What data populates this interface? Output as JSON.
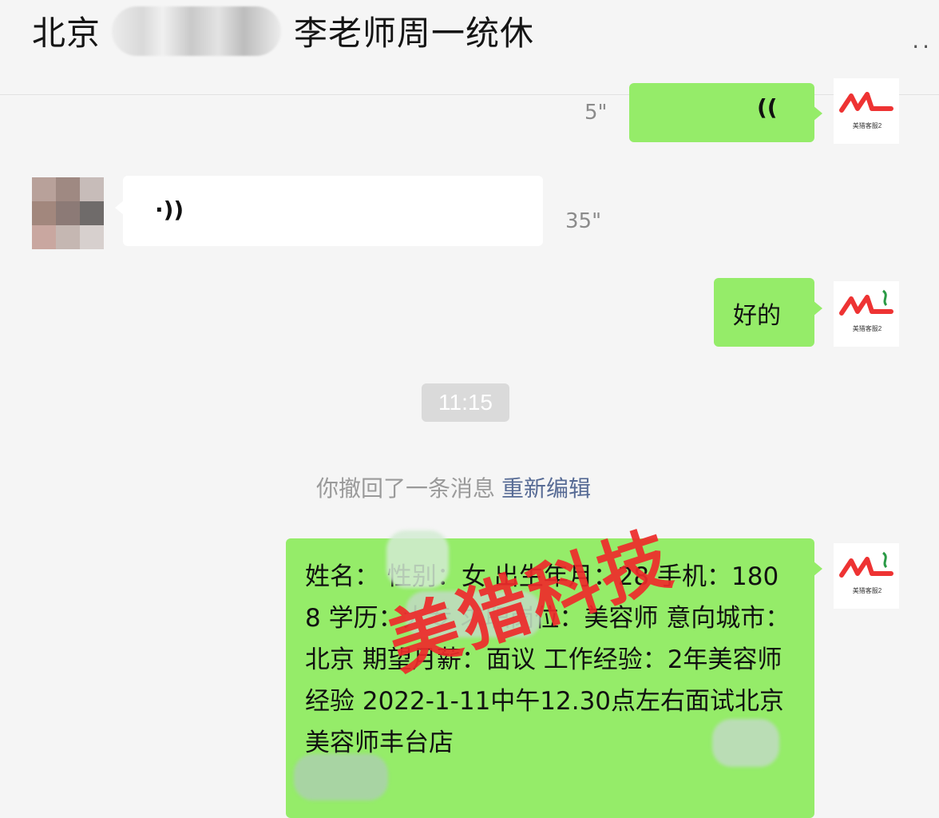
{
  "header": {
    "title_prefix": "北京",
    "title_suffix": "李老师周一统休",
    "more_label": "··"
  },
  "messages": {
    "voice_out_1": {
      "duration": "5\"",
      "icon": "(("
    },
    "voice_in_1": {
      "duration": "35\"",
      "icon": "·))"
    },
    "text_out_1": {
      "text": "好的"
    },
    "time_divider": "11:15",
    "recall": {
      "text": "你撤回了一条消息",
      "link": "重新编辑"
    },
    "long_out": {
      "text": "姓名：    性别：女 出生年月：28 手机：180            8 学历：大专 求职岗位：美容师 意向城市：北京 期望月薪：面议 工作经验：2年美容师经验 2022-1-11中午12.30点左右面试北京        美容师丰台店"
    }
  },
  "avatar_logo": {
    "mark": "ML",
    "caption": "美猎客服2"
  },
  "watermark": "美猎科技",
  "colors": {
    "background": "#f5f5f5",
    "bubble_green": "#95ec69",
    "bubble_white": "#ffffff",
    "link_blue": "#576b95",
    "watermark_red": "#ee2b2b"
  }
}
